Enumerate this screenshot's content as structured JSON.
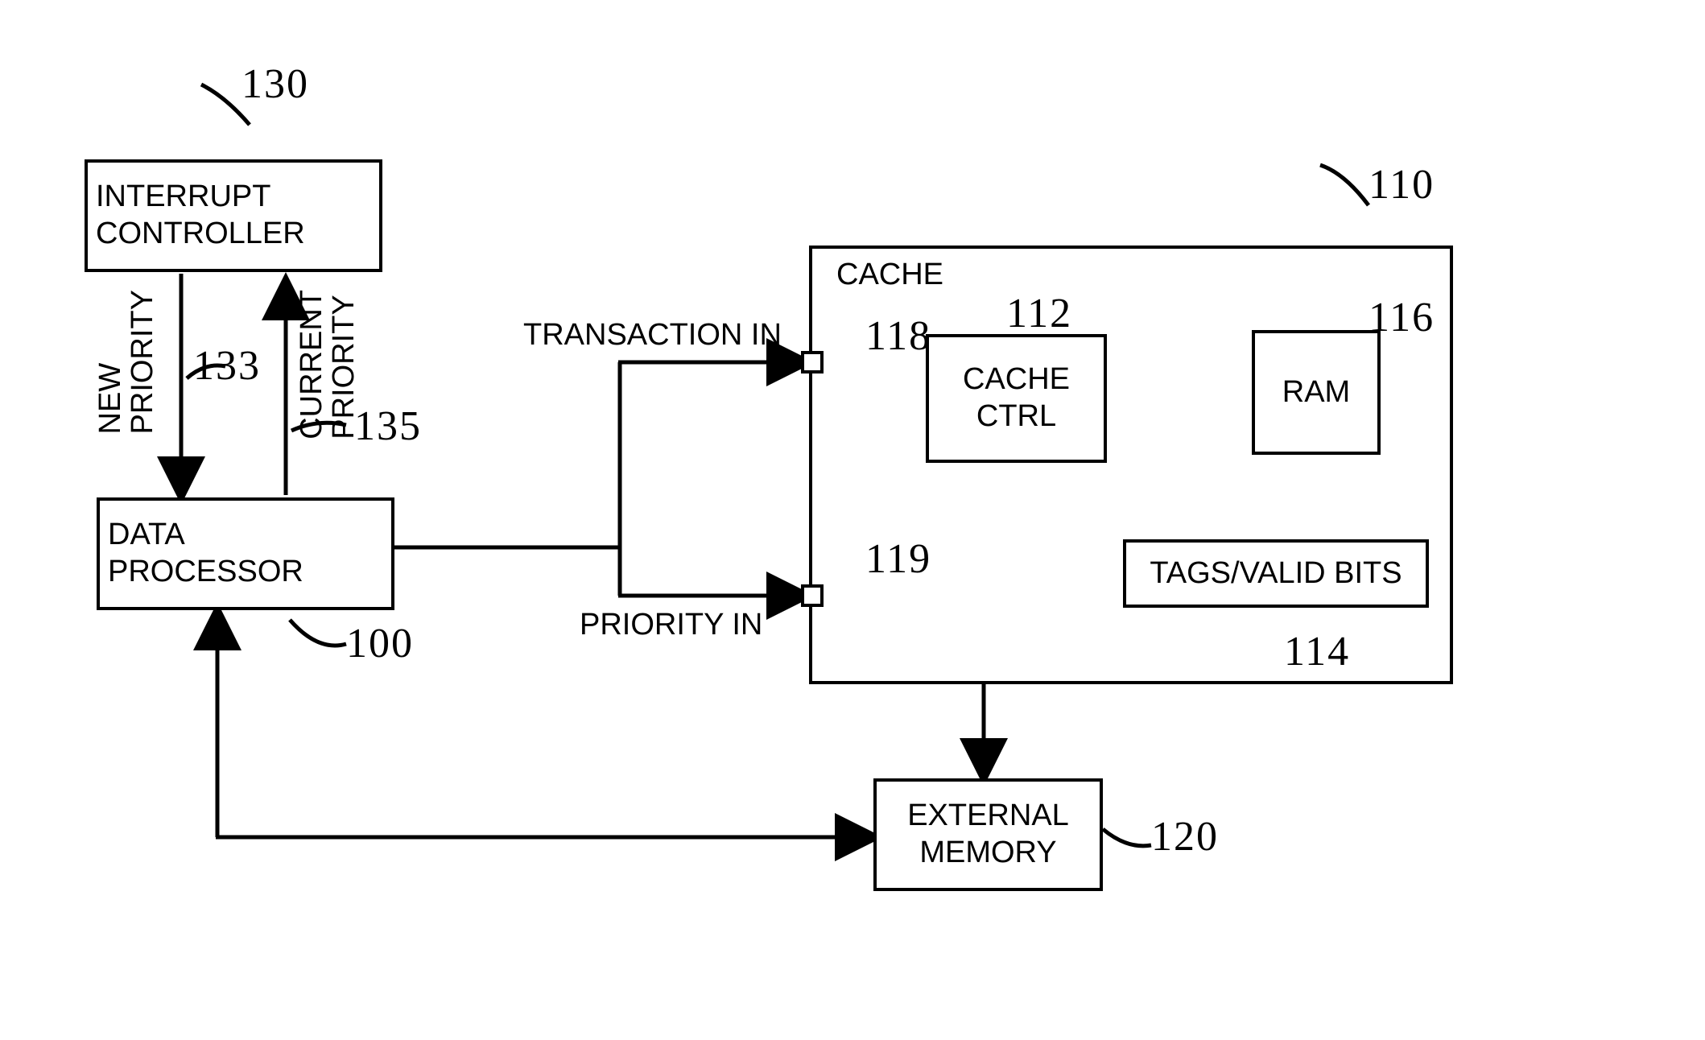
{
  "blocks": {
    "interrupt_controller": "INTERRUPT\nCONTROLLER",
    "data_processor": "DATA\nPROCESSOR",
    "external_memory": "EXTERNAL\nMEMORY",
    "cache_title": "CACHE",
    "cache_ctrl": "CACHE\nCTRL",
    "ram": "RAM",
    "tags_valid": "TAGS/VALID BITS"
  },
  "labels": {
    "new_priority": "NEW\nPRIORITY",
    "current_priority": "CURRENT\nPRIORITY",
    "transaction_in": "TRANSACTION IN",
    "priority_in": "PRIORITY IN"
  },
  "refs": {
    "r130": "130",
    "r133": "133",
    "r135": "135",
    "r100": "100",
    "r110": "110",
    "r112": "112",
    "r116": "116",
    "r114": "114",
    "r118": "118",
    "r119": "119",
    "r120": "120"
  }
}
